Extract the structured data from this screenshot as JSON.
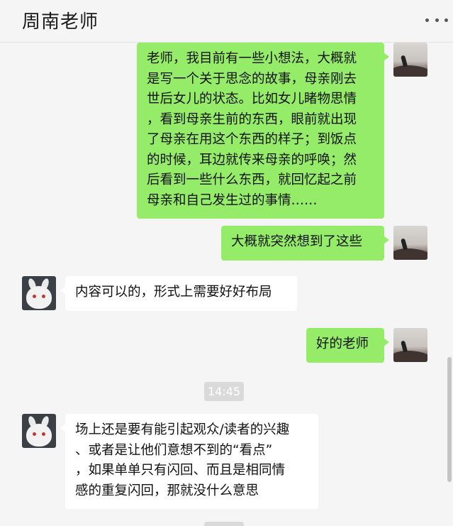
{
  "header": {
    "title": "周南老师",
    "more_icon": "more-dots-icon"
  },
  "messages": [
    {
      "sender": "me",
      "lines": [
        "老师，我目前有一些小想法，大概就",
        "是写一个关于思念的故事，母亲刚去",
        "世后女儿的状态。比如女儿睹物思情",
        "，看到母亲生前的东西，眼前就出现",
        "了母亲在用这个东西的样子；到饭点",
        "的时候，耳边就传来母亲的呼唤；然",
        "后看到一些什么东西，就回忆起之前",
        "母亲和自己发生过的事情……"
      ]
    },
    {
      "sender": "me",
      "lines": [
        "大概就突然想到了这些"
      ]
    },
    {
      "sender": "other",
      "lines": [
        "内容可以的，形式上需要好好布局"
      ]
    },
    {
      "sender": "me",
      "lines": [
        "好的老师"
      ]
    },
    {
      "sender": "other",
      "lines": [
        "场上还是要有能引起观众/读者的兴趣",
        "、或者是让他们意想不到的“看点”",
        "，如果单单只有闪回、而且是相同情",
        "感的重复闪回，那就没什么意思"
      ]
    }
  ],
  "timestamp": "14:45",
  "colors": {
    "background": "#f5f5f5",
    "my_bubble": "#95ec69",
    "their_bubble": "#ffffff",
    "timestamp_bg": "#dadada"
  }
}
